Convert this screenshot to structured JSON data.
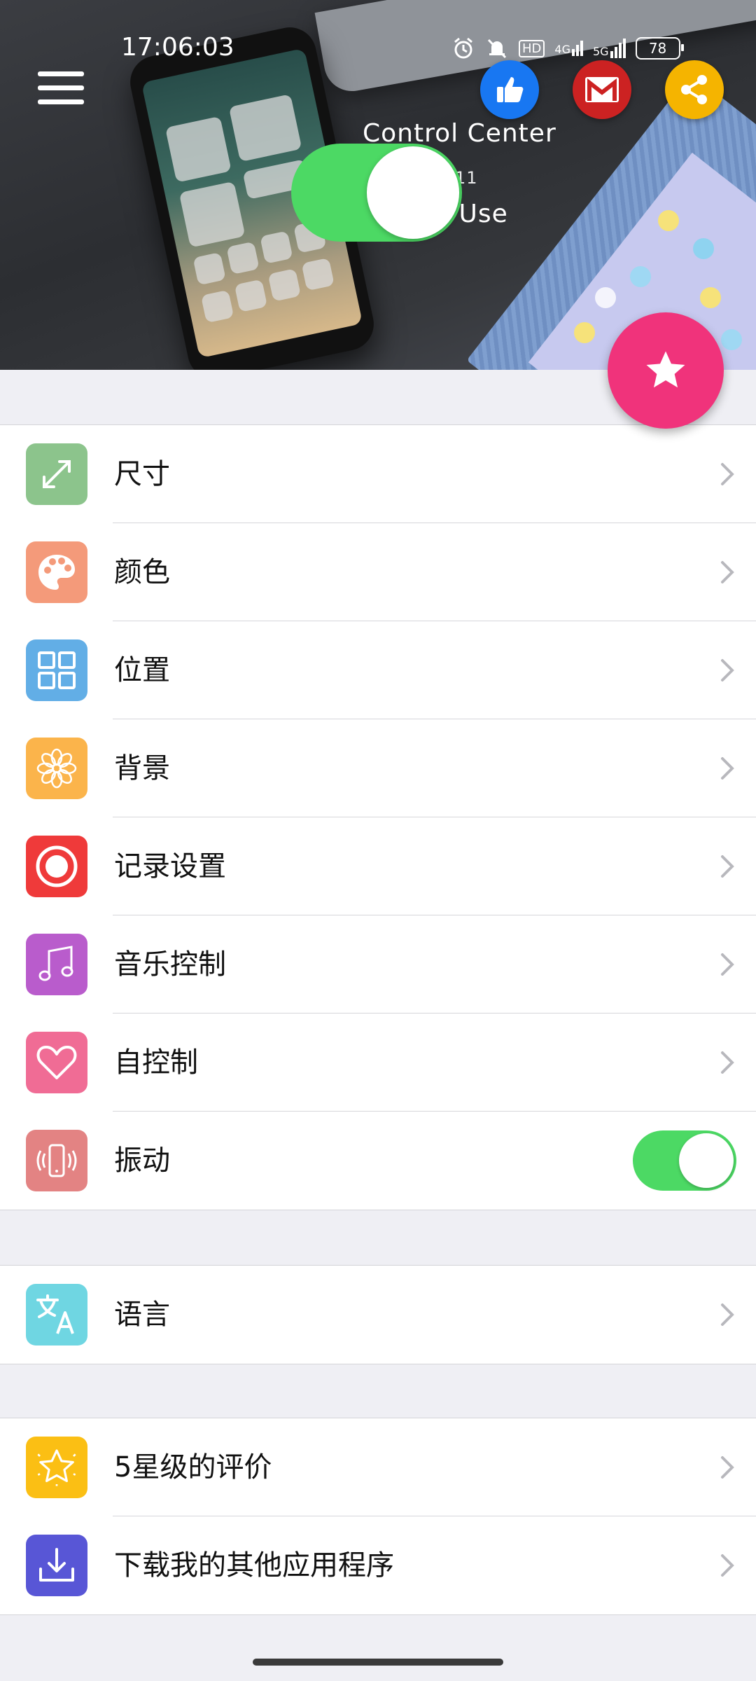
{
  "status_bar": {
    "time": "17:06:03",
    "network_hd": "HD",
    "network_4g": "4G",
    "network_5g": "5G",
    "battery": "78"
  },
  "banner": {
    "title": "Control Center",
    "subtitle": "11",
    "caption": "o Use"
  },
  "colors": {
    "toggle_on": "#4cd964",
    "fab": "#f0337b",
    "like_button": "#1877f2",
    "mail_button": "#cc2222",
    "share_button": "#f5b400"
  },
  "settings": {
    "group1": [
      {
        "label": "尺寸",
        "icon": "resize-icon",
        "color": "#8cc48c"
      },
      {
        "label": "颜色",
        "icon": "palette-icon",
        "color": "#f49a7a"
      },
      {
        "label": "位置",
        "icon": "grid-icon",
        "color": "#62aee6"
      },
      {
        "label": "背景",
        "icon": "flower-icon",
        "color": "#fbb44b"
      },
      {
        "label": "记录设置",
        "icon": "record-icon",
        "color": "#ef3a3a"
      },
      {
        "label": "音乐控制",
        "icon": "music-note-icon",
        "color": "#b95ccc"
      },
      {
        "label": "自控制",
        "icon": "heart-icon",
        "color": "#f06c95"
      },
      {
        "label": "振动",
        "icon": "vibrate-phone-icon",
        "color": "#e38383",
        "toggle": "on"
      }
    ],
    "group2": [
      {
        "label": "语言",
        "icon": "translate-icon",
        "color": "#6fd6e2"
      }
    ],
    "group3": [
      {
        "label": "5星级的评价",
        "icon": "star-icon",
        "color": "#fbbf14"
      },
      {
        "label": "下载我的其他应用程序",
        "icon": "download-icon",
        "color": "#5856d6"
      }
    ]
  }
}
